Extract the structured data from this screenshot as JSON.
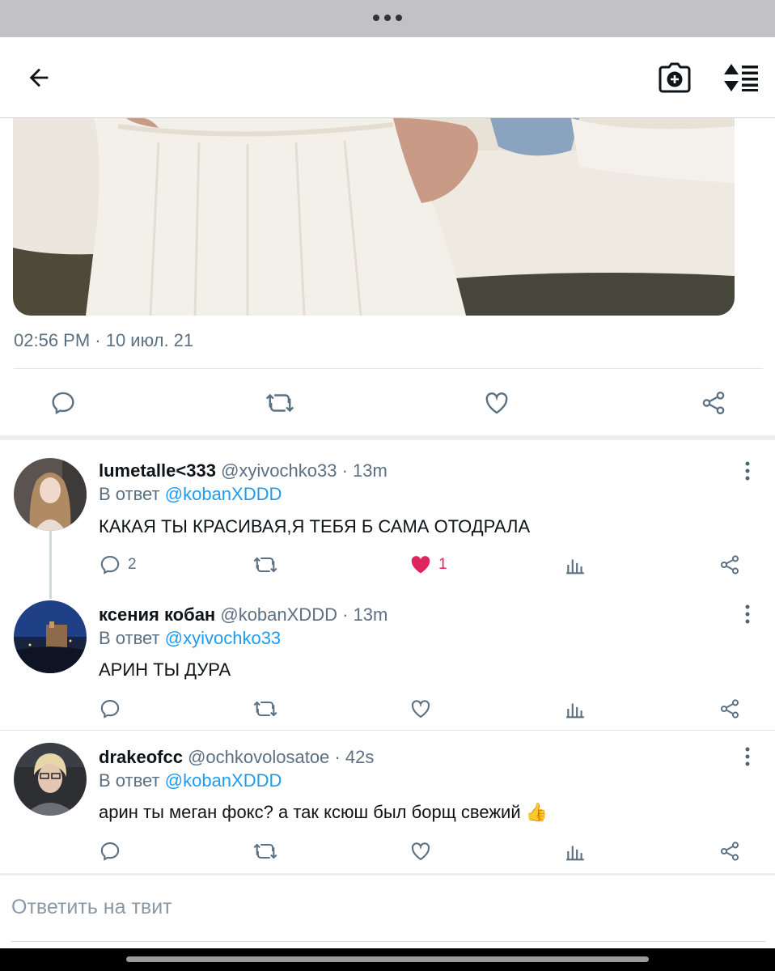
{
  "header": {
    "back_icon": "arrow-left-icon",
    "camera_icon": "camera-add-icon",
    "sort_icon": "sort-icon"
  },
  "tweet": {
    "timestamp": "02:56 PM · 10 июл. 21",
    "actions": [
      "reply-icon",
      "retweet-icon",
      "like-icon",
      "share-icon"
    ]
  },
  "replies": [
    {
      "name": "lumetalle<333",
      "handle": "@xyivochko33",
      "time": "13m",
      "in_reply_prefix": "В ответ",
      "in_reply_to": "@kobanXDDD",
      "text": "КАКАЯ ТЫ КРАСИВАЯ,Я ТЕБЯ Б САМА ОТОДРАЛА",
      "reply_count": "2",
      "like_count": "1",
      "liked": true
    },
    {
      "name": "ксения кобан",
      "handle": "@kobanXDDD",
      "time": "13m",
      "in_reply_prefix": "В ответ",
      "in_reply_to": "@xyivochko33",
      "text": "АРИН ТЫ ДУРА",
      "reply_count": "",
      "like_count": "",
      "liked": false
    },
    {
      "name": "drakeofcc",
      "handle": "@ochkovolosatoe",
      "time": "42s",
      "in_reply_prefix": "В ответ",
      "in_reply_to": "@kobanXDDD",
      "text": "арин ты меган фокс? а так ксюш был борщ свежий 👍",
      "reply_count": "",
      "like_count": "",
      "liked": false
    }
  ],
  "compose": {
    "placeholder": "Ответить на твит"
  },
  "colors": {
    "accent": "#1d9bf0",
    "like": "#e0245e",
    "muted": "#5b7083"
  }
}
